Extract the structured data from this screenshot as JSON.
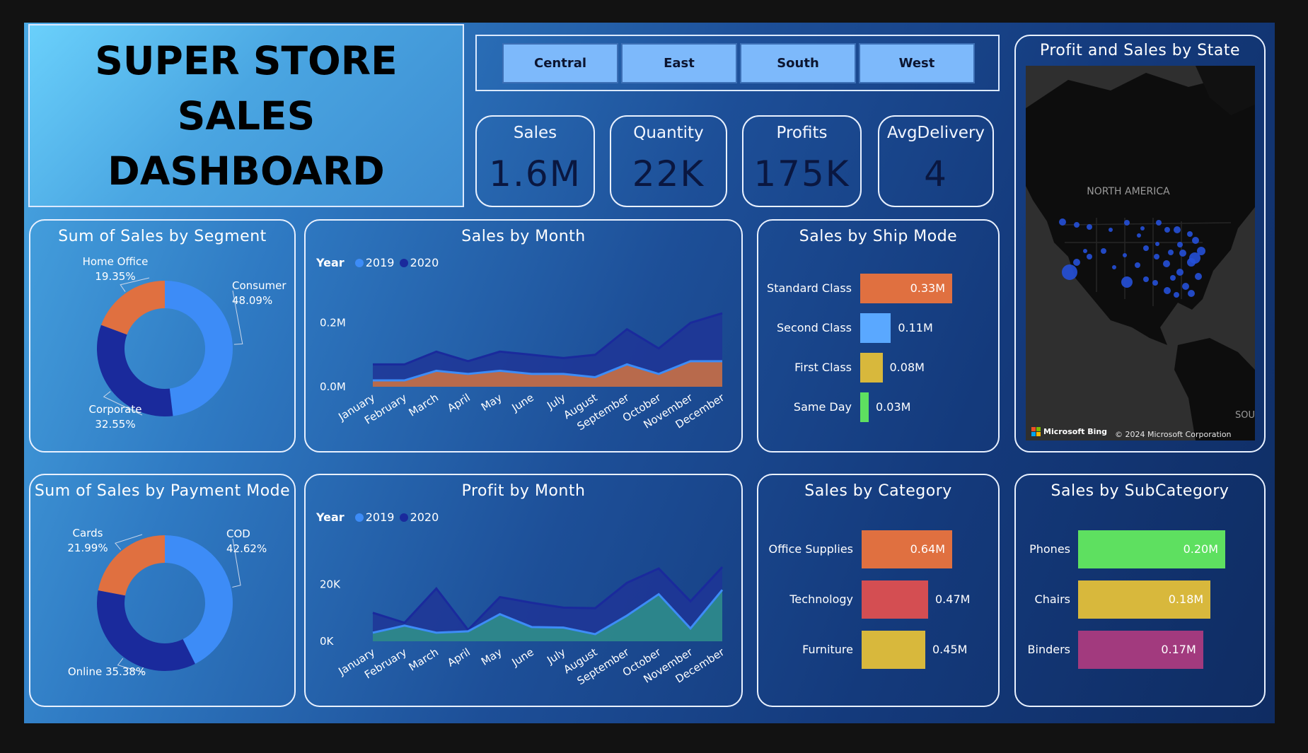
{
  "header": {
    "title_lines": [
      "SUPER STORE",
      "SALES",
      "DASHBOARD"
    ]
  },
  "region_slicer": {
    "options": [
      "Central",
      "East",
      "South",
      "West"
    ]
  },
  "kpis": [
    {
      "label": "Sales",
      "value": "1.6M"
    },
    {
      "label": "Quantity",
      "value": "22K"
    },
    {
      "label": "Profits",
      "value": "175K"
    },
    {
      "label": "AvgDelivery",
      "value": "4"
    }
  ],
  "colors": {
    "series_2019": "#3d8cf7",
    "series_2020": "#1a2a9c",
    "orange": "#e07040",
    "light_blue": "#5aa8ff",
    "yellow": "#d8b83c",
    "green": "#5ee060",
    "red": "#d44e52",
    "magenta": "#a23a7e"
  },
  "map": {
    "title": "Profit and Sales by State",
    "region_label": "NORTH AMERICA",
    "south_label": "SOUTH",
    "bing_label": "Microsoft Bing",
    "copyright": "© 2024 Microsoft Corporation"
  },
  "chart_data": [
    {
      "type": "pie",
      "title": "Sum of Sales by Segment",
      "slices": [
        {
          "name": "Consumer",
          "value": 48.09,
          "label": "48.09%",
          "color": "#3d8cf7"
        },
        {
          "name": "Corporate",
          "value": 32.55,
          "label": "32.55%",
          "color": "#1a2a9c"
        },
        {
          "name": "Home Office",
          "value": 19.35,
          "label": "19.35%",
          "color": "#e07040"
        }
      ]
    },
    {
      "type": "area",
      "title": "Sales by Month",
      "legend_title": "Year",
      "categories": [
        "January",
        "February",
        "March",
        "April",
        "May",
        "June",
        "July",
        "August",
        "September",
        "October",
        "November",
        "December"
      ],
      "yticks": [
        "0.0M",
        "0.2M"
      ],
      "ylim": [
        0,
        0.25
      ],
      "series": [
        {
          "name": "2019",
          "values": [
            0.02,
            0.02,
            0.05,
            0.04,
            0.05,
            0.04,
            0.04,
            0.03,
            0.07,
            0.04,
            0.08,
            0.08
          ]
        },
        {
          "name": "2020",
          "values": [
            0.07,
            0.07,
            0.11,
            0.08,
            0.11,
            0.1,
            0.09,
            0.1,
            0.18,
            0.12,
            0.2,
            0.23
          ]
        }
      ]
    },
    {
      "type": "bar",
      "orientation": "horizontal",
      "title": "Sales by Ship Mode",
      "categories": [
        "Standard Class",
        "Second Class",
        "First Class",
        "Same Day"
      ],
      "values": [
        0.33,
        0.11,
        0.08,
        0.03
      ],
      "labels": [
        "0.33M",
        "0.11M",
        "0.08M",
        "0.03M"
      ],
      "colors": [
        "#e07040",
        "#5aa8ff",
        "#d8b83c",
        "#5ee060"
      ]
    },
    {
      "type": "pie",
      "title": "Sum of Sales by Payment Mode",
      "slices": [
        {
          "name": "COD",
          "value": 42.62,
          "label": "42.62%",
          "color": "#3d8cf7"
        },
        {
          "name": "Online",
          "value": 35.38,
          "label": "35.38%",
          "color": "#1a2a9c"
        },
        {
          "name": "Cards",
          "value": 21.99,
          "label": "21.99%",
          "color": "#e07040"
        }
      ]
    },
    {
      "type": "area",
      "title": "Profit by Month",
      "legend_title": "Year",
      "categories": [
        "January",
        "February",
        "March",
        "April",
        "May",
        "June",
        "July",
        "August",
        "September",
        "October",
        "November",
        "December"
      ],
      "yticks": [
        "0K",
        "20K"
      ],
      "ylim": [
        0,
        28000
      ],
      "series": [
        {
          "name": "2019",
          "values": [
            3000,
            5500,
            3000,
            3500,
            9500,
            5000,
            4800,
            2500,
            9000,
            16500,
            4500,
            18000
          ]
        },
        {
          "name": "2020",
          "values": [
            10000,
            6500,
            18500,
            4000,
            15500,
            13500,
            11800,
            11600,
            20500,
            25500,
            14000,
            26000
          ]
        }
      ]
    },
    {
      "type": "bar",
      "orientation": "horizontal",
      "title": "Sales by Category",
      "categories": [
        "Office Supplies",
        "Technology",
        "Furniture"
      ],
      "values": [
        0.64,
        0.47,
        0.45
      ],
      "labels": [
        "0.64M",
        "0.47M",
        "0.45M"
      ],
      "colors": [
        "#e07040",
        "#d44e52",
        "#d8b83c"
      ]
    },
    {
      "type": "bar",
      "orientation": "horizontal",
      "title": "Sales by SubCategory",
      "categories": [
        "Phones",
        "Chairs",
        "Binders"
      ],
      "values": [
        0.2,
        0.18,
        0.17
      ],
      "labels": [
        "0.20M",
        "0.18M",
        "0.17M"
      ],
      "colors": [
        "#5ee060",
        "#d8b83c",
        "#a23a7e"
      ]
    }
  ]
}
